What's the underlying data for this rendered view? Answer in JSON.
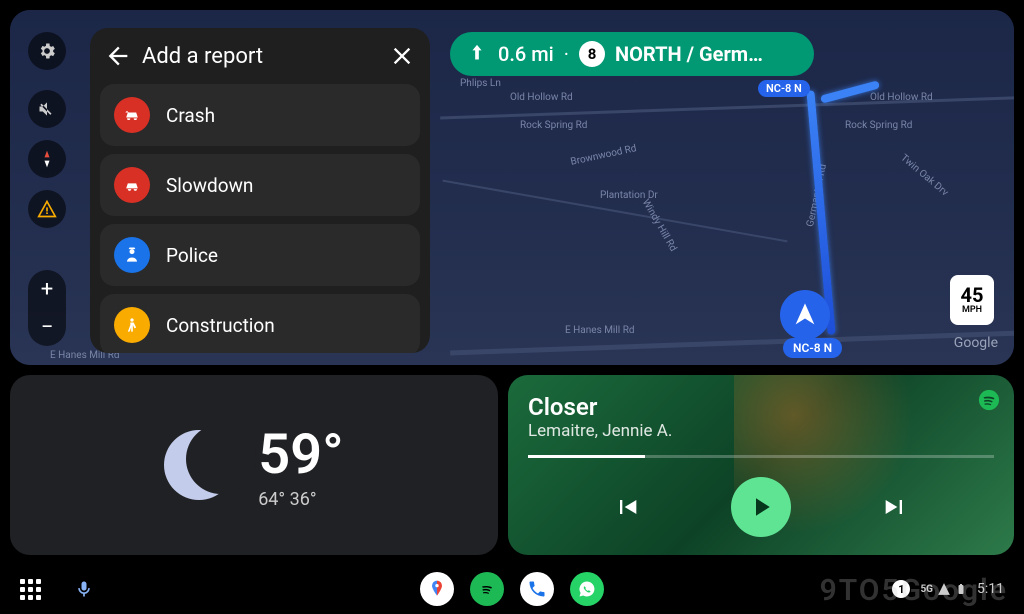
{
  "report_panel": {
    "title": "Add a report",
    "items": [
      {
        "label": "Crash",
        "icon": "crash-icon",
        "bg": "#d93025"
      },
      {
        "label": "Slowdown",
        "icon": "slowdown-icon",
        "bg": "#d93025"
      },
      {
        "label": "Police",
        "icon": "police-icon",
        "bg": "#1a73e8"
      },
      {
        "label": "Construction",
        "icon": "construction-icon",
        "bg": "#f9ab00"
      }
    ]
  },
  "direction": {
    "distance": "0.6 mi",
    "route_number": "8",
    "road_name": "NORTH / Germ…"
  },
  "route_pills": {
    "top": "NC-8 N",
    "bottom": "NC-8 N"
  },
  "speed_limit": {
    "value": "45",
    "unit": "MPH"
  },
  "map_attribution": "Google",
  "road_labels": {
    "old_hollow_1": "Old Hollow Rd",
    "old_hollow_2": "Old Hollow Rd",
    "rock_spring_1": "Rock Spring Rd",
    "rock_spring_2": "Rock Spring Rd",
    "plantation": "Plantation Dr",
    "windy_hill": "Windy Hill Rd",
    "twin_oak": "Twin Oak Drv",
    "germanton": "Germanton Rd",
    "e_hanes_1": "E Hanes Mill Rd",
    "e_hanes_2": "E Hanes Mill Rd",
    "brownwood": "Brownwood Rd",
    "phlips": "Phlips Ln"
  },
  "weather": {
    "temp": "59°",
    "high": "64°",
    "low": "36°"
  },
  "music": {
    "title": "Closer",
    "artist": "Lemaitre, Jennie A.",
    "progress_pct": "25%"
  },
  "status": {
    "network": "5G",
    "time": "5:11",
    "notif_count": "1"
  },
  "watermark": "9TO5Google"
}
